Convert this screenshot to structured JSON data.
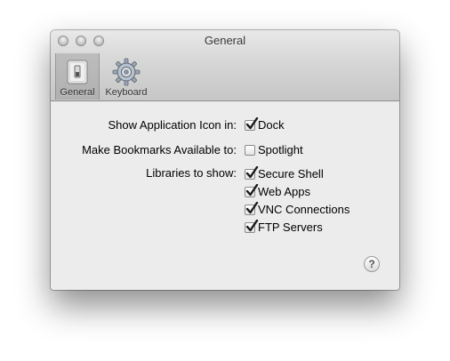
{
  "window": {
    "title": "General"
  },
  "toolbar": {
    "items": [
      {
        "label": "General",
        "icon": "switch-icon",
        "selected": true
      },
      {
        "label": "Keyboard",
        "icon": "gear-icon",
        "selected": false
      }
    ]
  },
  "settings": {
    "show_app_icon": {
      "label": "Show Application Icon in:",
      "options": [
        {
          "label": "Dock",
          "checked": true
        }
      ]
    },
    "bookmarks": {
      "label": "Make Bookmarks Available to:",
      "options": [
        {
          "label": "Spotlight",
          "checked": false
        }
      ]
    },
    "libraries": {
      "label": "Libraries to show:",
      "options": [
        {
          "label": "Secure Shell",
          "checked": true
        },
        {
          "label": "Web Apps",
          "checked": true
        },
        {
          "label": "VNC Connections",
          "checked": true
        },
        {
          "label": "FTP Servers",
          "checked": true
        }
      ]
    }
  },
  "help": {
    "label": "?"
  }
}
